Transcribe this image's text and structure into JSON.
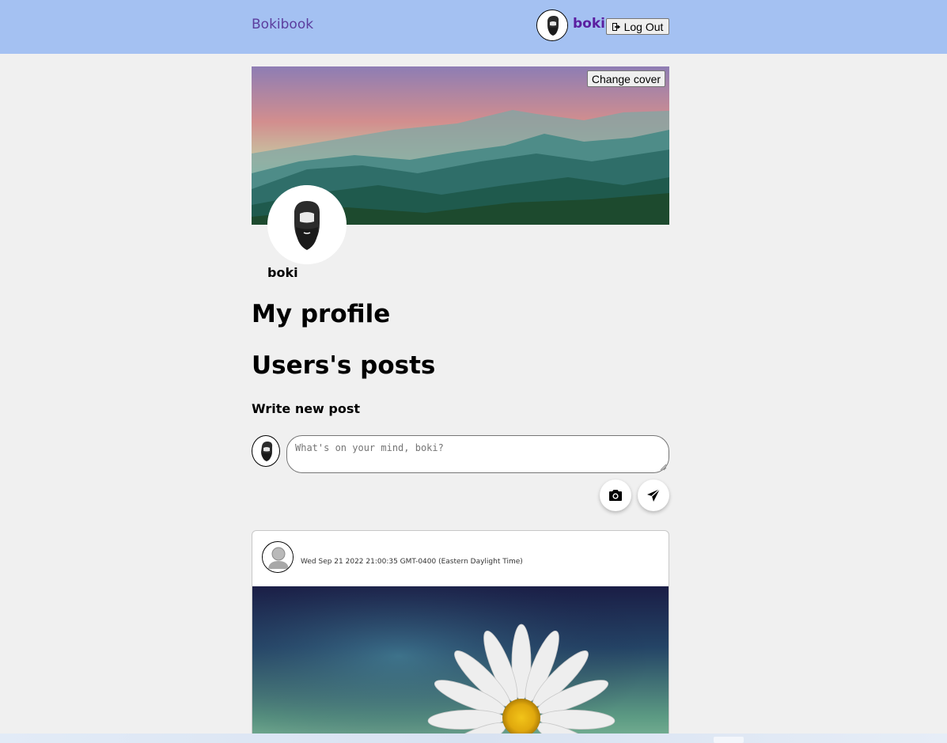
{
  "header": {
    "brand": "Bokibook",
    "username": "boki",
    "logout_label": "Log Out",
    "logout_icon": "sign-out-icon",
    "background_color": "#a4c1f2",
    "brand_color": "#5b3d9e"
  },
  "profile": {
    "change_cover_label": "Change cover",
    "name": "boki",
    "cover_image": "mountain-landscape"
  },
  "page": {
    "my_profile_heading": "My profile",
    "posts_heading": "Users's posts",
    "write_heading": "Write new post"
  },
  "composer": {
    "placeholder": "What's on your mind, boki?",
    "camera_icon": "camera-icon",
    "send_icon": "paper-plane-icon"
  },
  "posts": [
    {
      "date": "Wed Sep 21 2022 21:00:35 GMT-0400 (Eastern Daylight Time)",
      "avatar": "default-user-icon",
      "image": "white-daisy-flower"
    }
  ]
}
